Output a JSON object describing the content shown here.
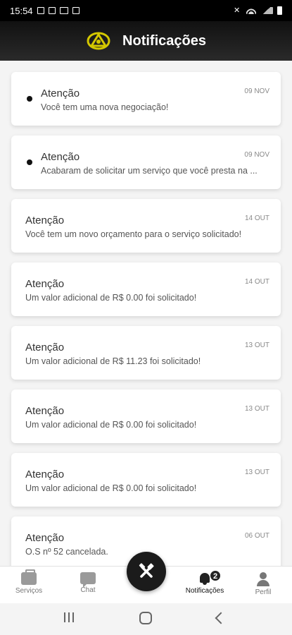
{
  "status_bar": {
    "time": "15:54",
    "left_icons": [
      "gallery-icon",
      "photo-icon",
      "laptop-icon",
      "screenshot-icon"
    ],
    "right_icons": [
      "mute-icon",
      "wifi-icon",
      "signal-icon",
      "battery-icon"
    ]
  },
  "header": {
    "title": "Notificações",
    "accent_color": "#d4c800"
  },
  "notifications": [
    {
      "title": "Atenção",
      "message": "Você tem uma nova negociação!",
      "date": "09 NOV",
      "unread": true
    },
    {
      "title": "Atenção",
      "message": "Acabaram de solicitar um serviço que você presta na ...",
      "date": "09 NOV",
      "unread": true
    },
    {
      "title": "Atenção",
      "message": "Você tem um novo orçamento para o serviço solicitado!",
      "date": "14 OUT",
      "unread": false
    },
    {
      "title": "Atenção",
      "message": "Um valor adicional de R$ 0.00 foi solicitado!",
      "date": "14 OUT",
      "unread": false
    },
    {
      "title": "Atenção",
      "message": "Um valor adicional de R$ 11.23 foi solicitado!",
      "date": "13 OUT",
      "unread": false
    },
    {
      "title": "Atenção",
      "message": "Um valor adicional de R$ 0.00 foi solicitado!",
      "date": "13 OUT",
      "unread": false
    },
    {
      "title": "Atenção",
      "message": "Um valor adicional de R$ 0.00 foi solicitado!",
      "date": "13 OUT",
      "unread": false
    },
    {
      "title": "Atenção",
      "message": "O.S nº 52 cancelada.",
      "date": "06 OUT",
      "unread": false
    }
  ],
  "bottom_nav": {
    "items": [
      {
        "label": "Serviços",
        "icon": "briefcase-icon"
      },
      {
        "label": "Chat",
        "icon": "chat-icon"
      },
      {
        "label": "Notificações",
        "icon": "bell-icon",
        "active": true
      },
      {
        "label": "Perfil",
        "icon": "person-icon"
      }
    ],
    "notification_badge": "2",
    "fab_icon": "tools-icon"
  },
  "system_nav": {
    "buttons": [
      "recent-apps-icon",
      "home-icon",
      "back-icon"
    ]
  }
}
